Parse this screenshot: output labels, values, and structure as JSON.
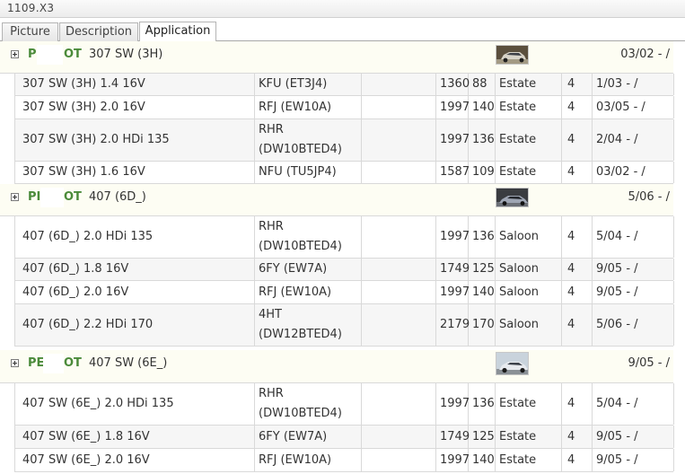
{
  "window": {
    "title": "1109.X3"
  },
  "tabs": [
    {
      "label": "Picture",
      "active": false
    },
    {
      "label": "Description",
      "active": false
    },
    {
      "label": "Application",
      "active": true
    }
  ],
  "groups": [
    {
      "brand_prefix": "P",
      "brand_suffix": "OT",
      "model": "307 SW (3H)",
      "date": "03/02 - /",
      "rows": [
        {
          "desc": "307 SW (3H) 1.4 16V",
          "engine": "KFU (ET3J4)",
          "cc": "1360",
          "kw": "88",
          "body": "Estate",
          "doors": "4",
          "date": "1/03 - /"
        },
        {
          "desc": "307 SW (3H) 2.0 16V",
          "engine": "RFJ (EW10A)",
          "cc": "1997",
          "kw": "140",
          "body": "Estate",
          "doors": "4",
          "date": "03/05 - /"
        },
        {
          "desc": "307 SW (3H) 2.0 HDi 135",
          "engine": "RHR (DW10BTED4)",
          "cc": "1997",
          "kw": "136",
          "body": "Estate",
          "doors": "4",
          "date": "2/04 - /"
        },
        {
          "desc": "307 SW (3H) 1.6 16V",
          "engine": "NFU (TU5JP4)",
          "cc": "1587",
          "kw": "109",
          "body": "Estate",
          "doors": "4",
          "date": "03/02 - /"
        }
      ]
    },
    {
      "brand_prefix": "PI",
      "brand_suffix": "OT",
      "model": "407 (6D_)",
      "date": "5/06 - /",
      "rows": [
        {
          "desc": "407 (6D_) 2.0 HDi 135",
          "engine": "RHR (DW10BTED4)",
          "cc": "1997",
          "kw": "136",
          "body": "Saloon",
          "doors": "4",
          "date": "5/04 - /"
        },
        {
          "desc": "407 (6D_) 1.8 16V",
          "engine": "6FY (EW7A)",
          "cc": "1749",
          "kw": "125",
          "body": "Saloon",
          "doors": "4",
          "date": "9/05 - /"
        },
        {
          "desc": "407 (6D_) 2.0 16V",
          "engine": "RFJ (EW10A)",
          "cc": "1997",
          "kw": "140",
          "body": "Saloon",
          "doors": "4",
          "date": "9/05 - /"
        },
        {
          "desc": "407 (6D_) 2.2 HDi 170",
          "engine": "4HT (DW12BTED4)",
          "cc": "2179",
          "kw": "170",
          "body": "Saloon",
          "doors": "4",
          "date": "5/06 - /"
        }
      ]
    },
    {
      "brand_prefix": "PE",
      "brand_suffix": "OT",
      "model": "407 SW (6E_)",
      "date": "9/05 - /",
      "rows": [
        {
          "desc": "407 SW (6E_) 2.0 HDi 135",
          "engine": "RHR (DW10BTED4)",
          "cc": "1997",
          "kw": "136",
          "body": "Estate",
          "doors": "4",
          "date": "5/04 - /"
        },
        {
          "desc": "407 SW (6E_) 1.8 16V",
          "engine": "6FY (EW7A)",
          "cc": "1749",
          "kw": "125",
          "body": "Estate",
          "doors": "4",
          "date": "9/05 - /"
        },
        {
          "desc": "407 SW (6E_) 2.0 16V",
          "engine": "RFJ (EW10A)",
          "cc": "1997",
          "kw": "140",
          "body": "Estate",
          "doors": "4",
          "date": "9/05 - /"
        }
      ]
    }
  ],
  "icons": {
    "expand": "expand-plus-icon",
    "vehicle_thumbnail": "car-thumbnail-image"
  },
  "colors": {
    "brand_text": "#4a8a3a",
    "group_row_bg": "#fdfdf3",
    "alt_row_bg": "#f6f6f6",
    "grid_line": "#d9d9d9"
  }
}
